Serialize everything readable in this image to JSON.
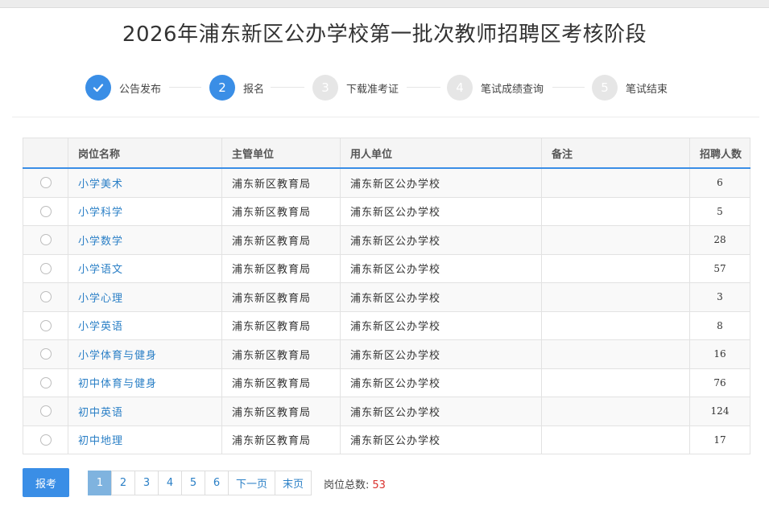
{
  "page": {
    "title": "2026年浦东新区公办学校第一批次教师招聘区考核阶段"
  },
  "steps": [
    {
      "number": "",
      "label": "公告发布",
      "state": "done",
      "icon": "check-icon"
    },
    {
      "number": "2",
      "label": "报名",
      "state": "active"
    },
    {
      "number": "3",
      "label": "下载准考证",
      "state": "pending"
    },
    {
      "number": "4",
      "label": "笔试成绩查询",
      "state": "pending"
    },
    {
      "number": "5",
      "label": "笔试结束",
      "state": "pending"
    }
  ],
  "table": {
    "headers": {
      "select": "",
      "position": "岗位名称",
      "authority": "主管单位",
      "employer": "用人单位",
      "note": "备注",
      "count": "招聘人数"
    },
    "rows": [
      {
        "position": "小学美术",
        "authority": "浦东新区教育局",
        "employer": "浦东新区公办学校",
        "note": "",
        "count": "6"
      },
      {
        "position": "小学科学",
        "authority": "浦东新区教育局",
        "employer": "浦东新区公办学校",
        "note": "",
        "count": "5"
      },
      {
        "position": "小学数学",
        "authority": "浦东新区教育局",
        "employer": "浦东新区公办学校",
        "note": "",
        "count": "28"
      },
      {
        "position": "小学语文",
        "authority": "浦东新区教育局",
        "employer": "浦东新区公办学校",
        "note": "",
        "count": "57"
      },
      {
        "position": "小学心理",
        "authority": "浦东新区教育局",
        "employer": "浦东新区公办学校",
        "note": "",
        "count": "3"
      },
      {
        "position": "小学英语",
        "authority": "浦东新区教育局",
        "employer": "浦东新区公办学校",
        "note": "",
        "count": "8"
      },
      {
        "position": "小学体育与健身",
        "authority": "浦东新区教育局",
        "employer": "浦东新区公办学校",
        "note": "",
        "count": "16"
      },
      {
        "position": "初中体育与健身",
        "authority": "浦东新区教育局",
        "employer": "浦东新区公办学校",
        "note": "",
        "count": "76"
      },
      {
        "position": "初中英语",
        "authority": "浦东新区教育局",
        "employer": "浦东新区公办学校",
        "note": "",
        "count": "124"
      },
      {
        "position": "初中地理",
        "authority": "浦东新区教育局",
        "employer": "浦东新区公办学校",
        "note": "",
        "count": "17"
      }
    ]
  },
  "actions": {
    "apply_label": "报考"
  },
  "pagination": {
    "pages": [
      "1",
      "2",
      "3",
      "4",
      "5",
      "6"
    ],
    "current": "1",
    "next_label": "下一页",
    "last_label": "末页"
  },
  "summary": {
    "total_label": "岗位总数:",
    "total_value": "53"
  },
  "colors": {
    "accent": "#3a8ee6",
    "link": "#2a7fc6",
    "total": "#d9302c",
    "pending": "#e6e6e6"
  }
}
